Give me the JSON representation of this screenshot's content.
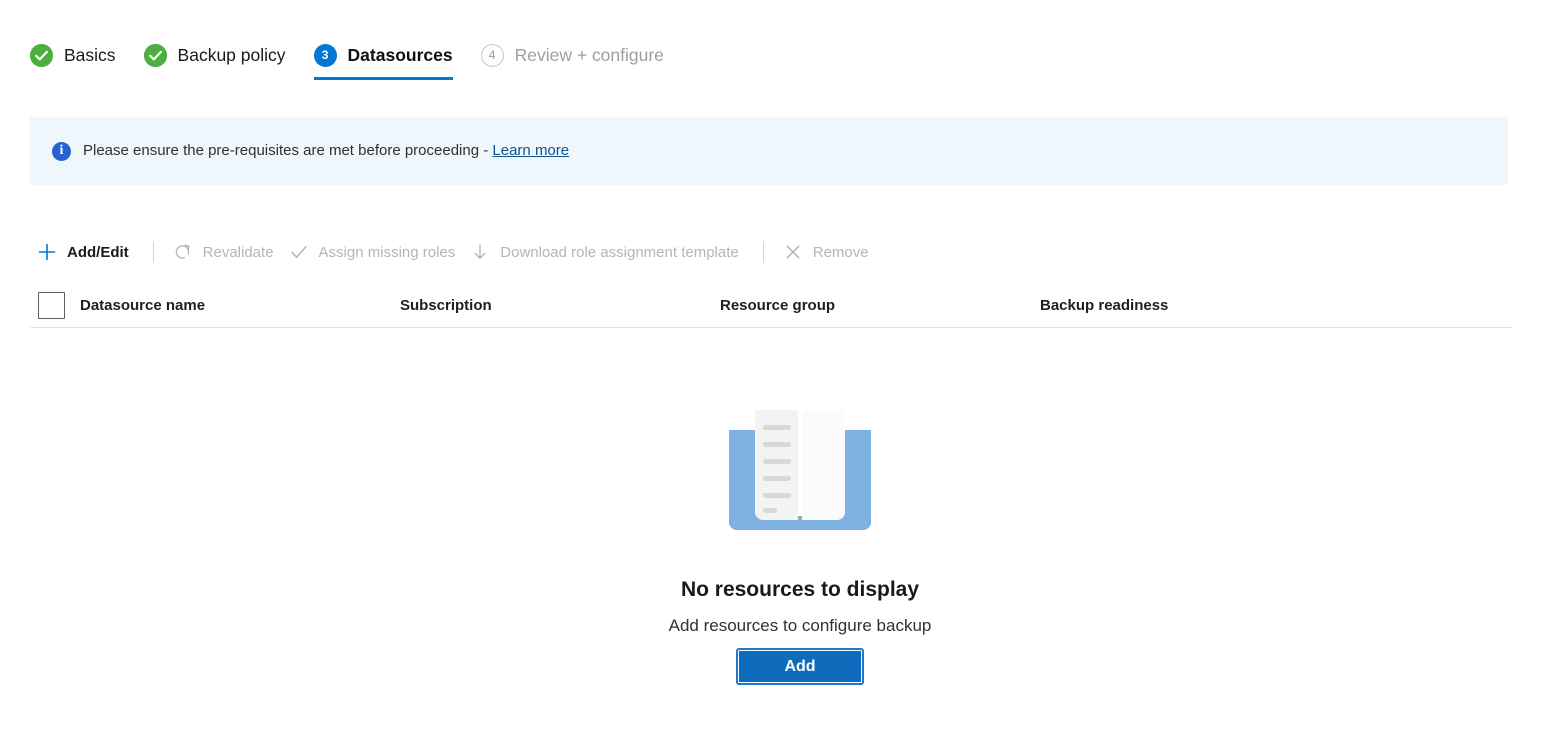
{
  "wizard": {
    "tabs": [
      {
        "label": "Basics",
        "state": "done",
        "marker": "check-icon"
      },
      {
        "label": "Backup policy",
        "state": "done",
        "marker": "check-icon"
      },
      {
        "label": "Datasources",
        "state": "current",
        "marker": "3"
      },
      {
        "label": "Review + configure",
        "state": "upcoming",
        "marker": "4"
      }
    ]
  },
  "banner": {
    "icon": "info-icon",
    "message": "Please ensure the pre-requisites are met before proceeding - ",
    "link_label": "Learn more"
  },
  "toolbar": {
    "commands": [
      {
        "label": "Add/Edit",
        "icon": "plus-icon",
        "enabled": true
      },
      {
        "label": "Revalidate",
        "icon": "refresh-icon",
        "enabled": false
      },
      {
        "label": "Assign missing roles",
        "icon": "check-icon",
        "enabled": false
      },
      {
        "label": "Download role assignment template",
        "icon": "download-icon",
        "enabled": false
      },
      {
        "label": "Remove",
        "icon": "close-icon",
        "enabled": false
      }
    ]
  },
  "table": {
    "select_all_checked": false,
    "columns": [
      "Datasource name",
      "Subscription",
      "Resource group",
      "Backup readiness"
    ],
    "rows": []
  },
  "empty_state": {
    "illustration": "open-book-icon",
    "title": "No resources to display",
    "subtitle": "Add resources to configure backup",
    "button_label": "Add"
  },
  "colors": {
    "accent": "#0078d4",
    "primary_button": "#0f6cbd",
    "success": "#4caf3f",
    "banner_background": "#eff6fc",
    "info_icon": "#2564cf",
    "book_cover": "#7fb1e0",
    "disabled_text": "#b7b5b3"
  }
}
